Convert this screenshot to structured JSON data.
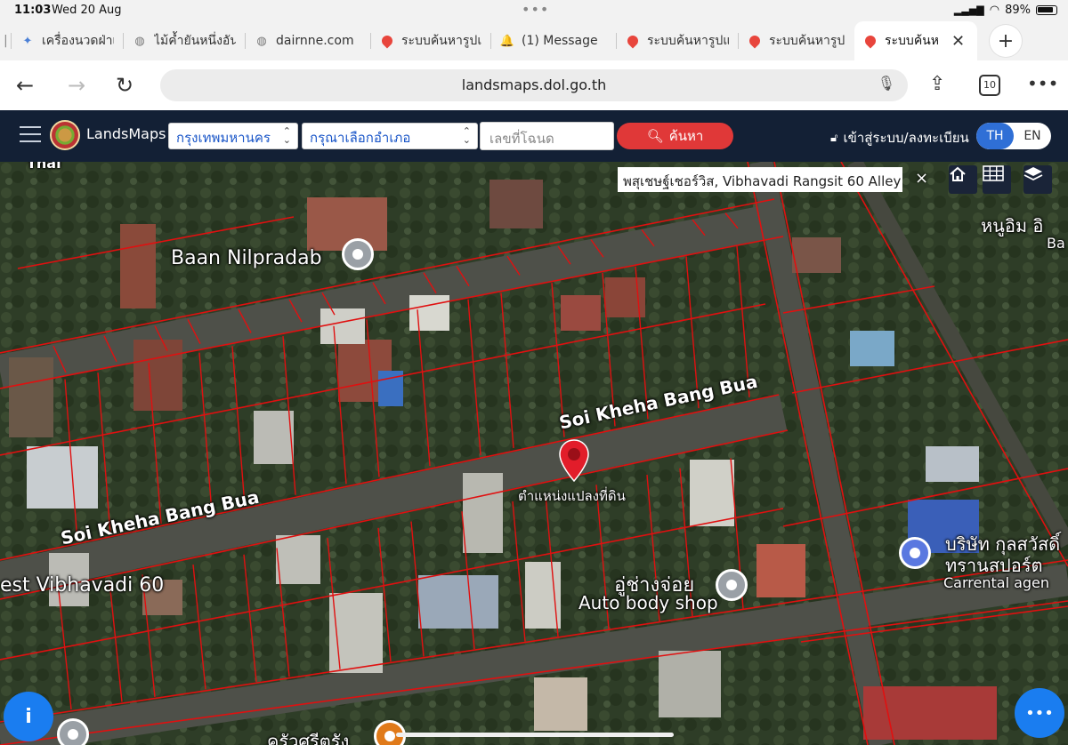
{
  "status_bar": {
    "time": "11:03",
    "date": "Wed 20 Aug",
    "battery": "89%"
  },
  "tabs": [
    {
      "label": "เครื่องนวดฝ่าเท้",
      "icon": "app-favicon-icon"
    },
    {
      "label": "ไม้ค้ำยันหนึ่งอัน",
      "icon": "globe-icon"
    },
    {
      "label": "dairnne.com",
      "icon": "globe-icon"
    },
    {
      "label": "ระบบค้นหารูปแ",
      "icon": "map-pin-icon"
    },
    {
      "label": "(1) Message",
      "icon": "bell-icon"
    },
    {
      "label": "ระบบค้นหารูปแ",
      "icon": "map-pin-icon"
    },
    {
      "label": "ระบบค้นหารูปแ",
      "icon": "map-pin-icon"
    },
    {
      "label": "ระบบค้นห",
      "icon": "map-pin-icon",
      "active": true
    }
  ],
  "browser": {
    "url": "landsmaps.dol.go.th",
    "tab_count": "10"
  },
  "app": {
    "brand": "LandsMaps",
    "province_select": "กรุงเทพมหานคร",
    "district_select": "กรุณาเลือกอำเภอ",
    "deed_placeholder": "เลขที่โฉนด",
    "search_label": "ค้นหา",
    "login_label": "เข้าสู่ระบบ/ลงทะเบียน",
    "lang_th": "TH",
    "lang_en": "EN"
  },
  "map": {
    "search_text": "พสุเชษฐ์เชอร์วิส, Vibhavadi Rangsit 60 Alley",
    "close_label": "×",
    "labels": {
      "baan_nilpradab": "Baan Nilpradab",
      "soi_north": "Soi Kheha Bang Bua",
      "soi_south": "Soi Kheha Bang Bua",
      "parcel_marker": "ตำแหน่งแปลงที่ดิน",
      "vibhavadi": "est Vibhavadi 60",
      "auto_thai": "อู่ช่างจ่อย",
      "auto_en": "Auto body shop",
      "company": "บริษัท กุลสวัสดิ์",
      "transport": "ทรานสปอร์ต",
      "carrental": "Carrental agen",
      "nu_im": "หนูอิม อิ",
      "ba": "Ba",
      "thai_top": "Thai",
      "bottom_place": "ครัวศรีตรัง"
    }
  },
  "colors": {
    "header_bg": "#132035",
    "search_button": "#e03838",
    "parcel_lines": "#e01010",
    "accent_blue": "#2f6fd6"
  }
}
